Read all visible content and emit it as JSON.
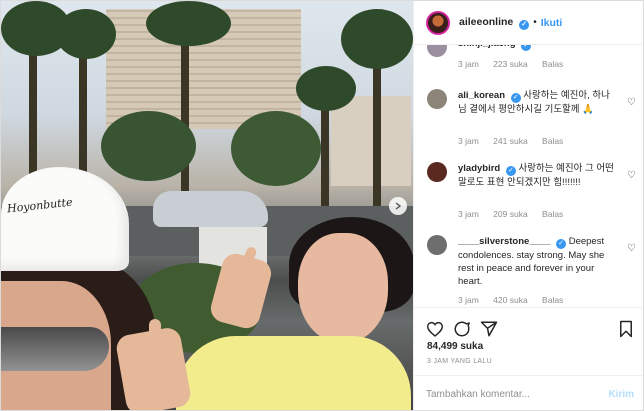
{
  "header": {
    "username": "aileeonline",
    "separator": "•",
    "follow_label": "Ikuti",
    "verified_mark": "✓"
  },
  "photo": {
    "hat_text": "Hoyonbutte"
  },
  "comments": [
    {
      "user": "shinji_jiaeng",
      "verified": true,
      "text": "",
      "time": "3 jam",
      "likes": "223 suka",
      "reply": "Balas",
      "avatar_color": "#9a8f9e"
    },
    {
      "user": "ali_korean",
      "verified": true,
      "text": "사랑하는 예진아, 하나님 곁에서 평안하시길 기도할께 🙏",
      "time": "3 jam",
      "likes": "241 suka",
      "reply": "Balas",
      "avatar_color": "#8c8478"
    },
    {
      "user": "yladybird",
      "verified": true,
      "text": "사랑하는 예진아 그 어떤말로도 표현 안되겠지만 힘!!!!!!!",
      "time": "3 jam",
      "likes": "209 suka",
      "reply": "Balas",
      "avatar_color": "#5a2a20"
    },
    {
      "user": "____silverstone____",
      "verified": true,
      "text": "Deepest condolences. stay strong. May she rest in peace and forever in your heart.",
      "time": "3 jam",
      "likes": "420 suka",
      "reply": "Balas",
      "avatar_color": "#6e6e6e"
    }
  ],
  "actions": {
    "like_icon": "heart-icon",
    "comment_icon": "comment-icon",
    "share_icon": "share-icon",
    "save_icon": "bookmark-icon"
  },
  "likes_count": "84,499 suka",
  "timestamp": "3 JAM YANG LALU",
  "add_comment": {
    "placeholder": "Tambahkan komentar...",
    "post_label": "Kirim"
  },
  "colors": {
    "accent": "#3897f0",
    "text": "#262626",
    "muted": "#8e8e8e"
  }
}
